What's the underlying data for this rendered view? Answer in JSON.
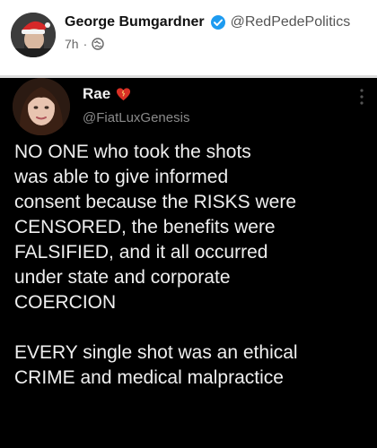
{
  "post": {
    "author_name": "George Bumgardner",
    "author_handle": "@RedPedePolitics",
    "time": "7h",
    "separator": "·",
    "icons": {
      "verified": "verified-badge-icon",
      "audience": "globe-icon"
    }
  },
  "embedded_tweet": {
    "name": "Rae",
    "handle": "@FiatLuxGenesis",
    "icons": {
      "name_emoji": "heart-emoji-icon",
      "menu": "more-vertical-icon"
    },
    "paragraph_1": [
      "NO ONE who took the shots",
      "was able to give informed",
      "consent because the RISKS were",
      "CENSORED, the benefits were",
      "FALSIFIED, and it all occurred",
      "under state and corporate",
      "COERCION"
    ],
    "paragraph_2": [
      "EVERY single shot was an ethical",
      "CRIME and medical malpractice"
    ]
  },
  "colors": {
    "verified_blue": "#1d9bf0",
    "embedded_background": "#000000",
    "embedded_text": "#efefef",
    "handle_gray": "#8a8a8a"
  }
}
